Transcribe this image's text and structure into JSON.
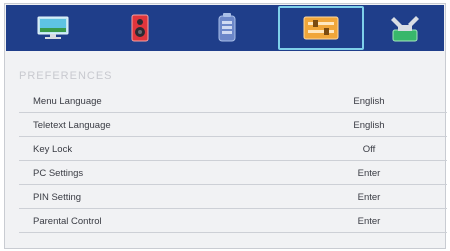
{
  "tabs": [
    {
      "name": "picture",
      "icon": "monitor-icon"
    },
    {
      "name": "sound",
      "icon": "speaker-icon"
    },
    {
      "name": "channel",
      "icon": "remote-icon"
    },
    {
      "name": "preferences",
      "icon": "settings-panel-icon",
      "selected": true
    },
    {
      "name": "setup",
      "icon": "tools-icon"
    }
  ],
  "section_title": "PREFERENCES",
  "items": [
    {
      "label": "Menu Language",
      "value": "English"
    },
    {
      "label": "Teletext Language",
      "value": "English"
    },
    {
      "label": "Key Lock",
      "value": "Off"
    },
    {
      "label": "PC Settings",
      "value": "Enter"
    },
    {
      "label": "PIN Setting",
      "value": "Enter"
    },
    {
      "label": "Parental Control",
      "value": "Enter"
    }
  ],
  "colors": {
    "tabbar": "#1f3e8a",
    "selected_border": "#7fd0ea",
    "panel": "#f1f2f4"
  }
}
